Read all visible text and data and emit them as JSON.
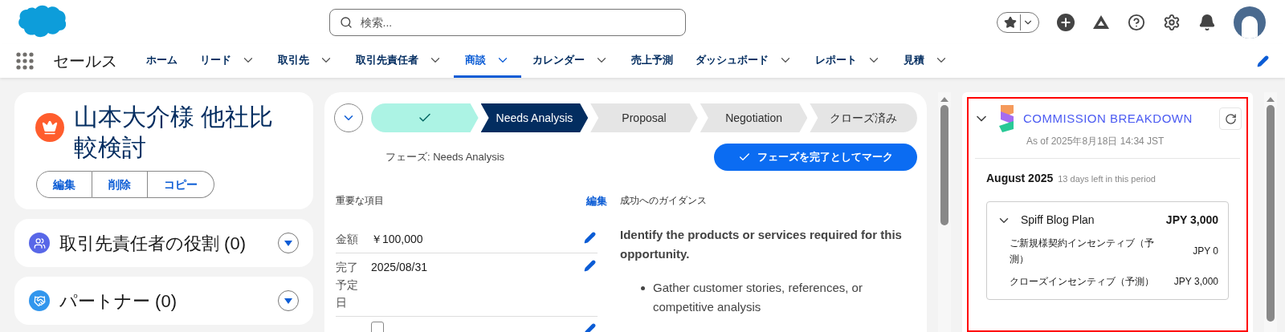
{
  "header": {
    "search": {
      "placeholder": "検索..."
    }
  },
  "nav": {
    "app_name": "セールス",
    "items": [
      {
        "label": "ホーム",
        "has_menu": false,
        "selected": false
      },
      {
        "label": "リード",
        "has_menu": true,
        "selected": false
      },
      {
        "label": "取引先",
        "has_menu": true,
        "selected": false
      },
      {
        "label": "取引先責任者",
        "has_menu": true,
        "selected": false
      },
      {
        "label": "商談",
        "has_menu": true,
        "selected": true
      },
      {
        "label": "カレンダー",
        "has_menu": true,
        "selected": false
      },
      {
        "label": "売上予測",
        "has_menu": false,
        "selected": false
      },
      {
        "label": "ダッシュボード",
        "has_menu": true,
        "selected": false
      },
      {
        "label": "レポート",
        "has_menu": true,
        "selected": false
      },
      {
        "label": "見積",
        "has_menu": true,
        "selected": false
      }
    ]
  },
  "record": {
    "title": "山本大介様 他社比較検討",
    "actions": [
      "編集",
      "削除",
      "コピー"
    ]
  },
  "related_lists": [
    {
      "title": "取引先責任者の役割 (0)",
      "kind": "contact-roles"
    },
    {
      "title": "パートナー (0)",
      "kind": "partners"
    }
  ],
  "path": {
    "stages": [
      {
        "completed": true,
        "selected": false
      },
      {
        "label": "Needs Analysis",
        "completed": false,
        "selected": true
      },
      {
        "label": "Proposal",
        "completed": false,
        "selected": false
      },
      {
        "label": "Negotiation",
        "completed": false,
        "selected": false
      },
      {
        "label": "クローズ済み",
        "completed": false,
        "selected": false
      }
    ],
    "phase": "フェーズ: Needs Analysis",
    "mark_button": "フェーズを完了としてマーク"
  },
  "key_fields": {
    "title": "重要な項目",
    "edit": "編集",
    "rows": [
      {
        "kind": "text",
        "label": "金額",
        "value": "￥100,000"
      },
      {
        "kind": "text",
        "label": "完了予定日",
        "value": "2025/08/31"
      },
      {
        "kind": "checkbox",
        "checked": false
      }
    ]
  },
  "guidance": {
    "title": "成功へのガイダンス",
    "heading": "Identify the products or services required for this opportunity.",
    "bullets": [
      "Gather customer stories, references, or competitive analysis"
    ]
  },
  "commission": {
    "title": "COMMISSION BREAKDOWN",
    "as_of": "As of 2025年8月18日 14:34 JST",
    "period": "August 2025",
    "period_note": "13 days left in this period",
    "plan": {
      "name": "Spiff Blog Plan",
      "total": "JPY 3,000",
      "lines": [
        {
          "label": "ご新規様契約インセンティブ（予測）",
          "amount": "JPY 0"
        },
        {
          "label": "クローズインセンティブ（予測）",
          "amount": "JPY 3,000"
        }
      ]
    }
  }
}
